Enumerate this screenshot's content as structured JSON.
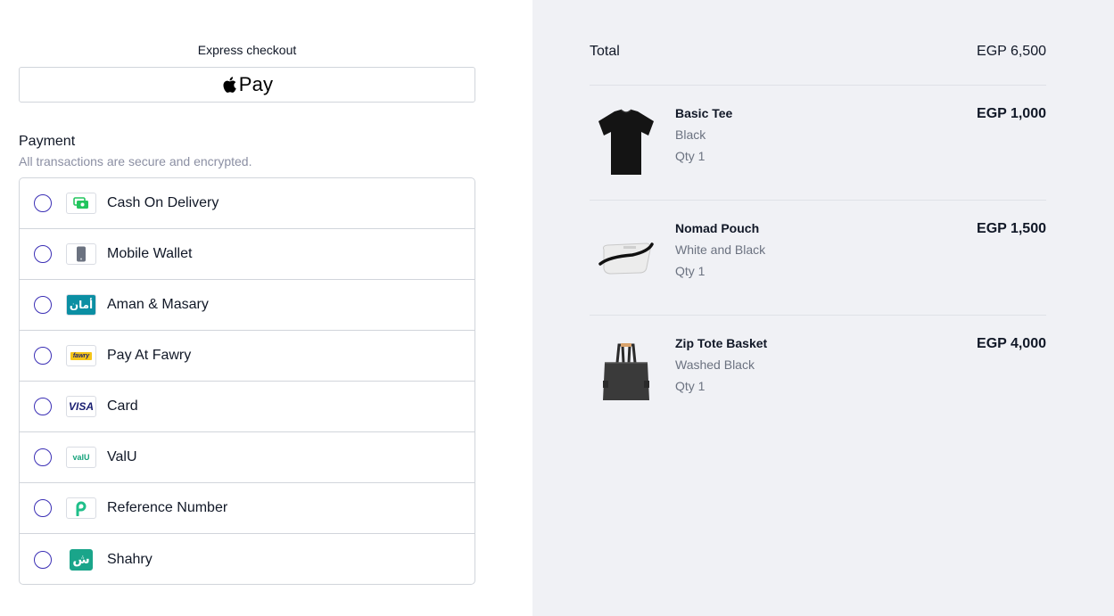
{
  "express": {
    "title": "Express checkout",
    "apple_pay_label": "Pay"
  },
  "payment": {
    "title": "Payment",
    "subtitle": "All transactions are secure and encrypted.",
    "methods": [
      {
        "label": "Cash On Delivery",
        "icon": "cash-icon"
      },
      {
        "label": "Mobile Wallet",
        "icon": "mobile-wallet-icon"
      },
      {
        "label": "Aman & Masary",
        "icon": "aman-icon",
        "icon_text": "أمان"
      },
      {
        "label": "Pay At Fawry",
        "icon": "fawry-icon",
        "icon_text": "fawry"
      },
      {
        "label": "Card",
        "icon": "visa-icon",
        "icon_text": "VISA"
      },
      {
        "label": "ValU",
        "icon": "valu-icon",
        "icon_text": "valU"
      },
      {
        "label": "Reference Number",
        "icon": "reference-icon"
      },
      {
        "label": "Shahry",
        "icon": "shahry-icon",
        "icon_text": "ش"
      }
    ]
  },
  "summary": {
    "total_label": "Total",
    "total_value": "EGP 6,500",
    "items": [
      {
        "name": "Basic Tee",
        "variant": "Black",
        "qty": "Qty 1",
        "price": "EGP 1,000",
        "image": "black-tshirt"
      },
      {
        "name": "Nomad Pouch",
        "variant": "White and Black",
        "qty": "Qty 1",
        "price": "EGP 1,500",
        "image": "white-pouch"
      },
      {
        "name": "Zip Tote Basket",
        "variant": "Washed Black",
        "qty": "Qty 1",
        "price": "EGP 4,000",
        "image": "black-tote"
      }
    ]
  },
  "colors": {
    "radio_border": "#3b2fb5",
    "summary_bg": "#f0f1f5",
    "cash_green": "#22c55e",
    "aman_teal": "#0b8fa3",
    "fawry_yellow": "#f5c518",
    "visa_navy": "#1a1f71",
    "shahry_green": "#1aa58a"
  }
}
